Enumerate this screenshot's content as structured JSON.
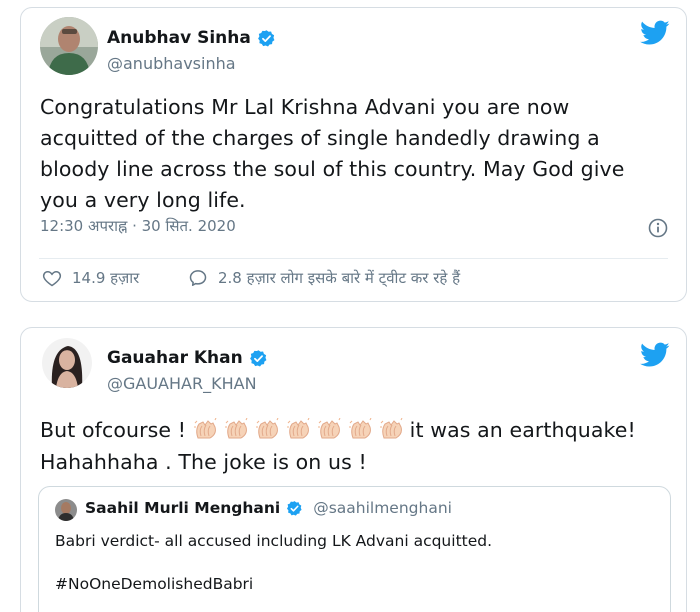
{
  "tweets": [
    {
      "author_name": "Anubhav Sinha",
      "handle": "@anubhavsinha",
      "text": "Congratulations Mr Lal Krishna Advani you are now acquitted of the charges of single handedly drawing a bloody line across the soul of this country. May God give you a very long life.",
      "timestamp": "12:30 अपराह्न · 30 सित. 2020",
      "likes": "14.9 हज़ार",
      "replies": "2.8 हज़ार लोग इसके बारे में ट्वीट कर रहे हैं"
    },
    {
      "author_name": "Gauahar Khan",
      "handle": "@GAUAHAR_KHAN",
      "text_before": "But ofcourse !",
      "clap_count": 7,
      "text_after": "it was an earthquake!",
      "text_line2": "Hahahhaha . The joke is on us !",
      "quoted": {
        "author_name": "Saahil Murli Menghani",
        "handle": "@saahilmenghani",
        "text": "Babri verdict- all accused including LK Advani acquitted.",
        "hashtag": "#NoOneDemolishedBabri"
      }
    }
  ],
  "icons": {
    "verified": "verified-badge-icon",
    "platform": "twitter-bird-icon",
    "info": "info-icon",
    "like": "heart-icon",
    "reply": "speech-bubble-icon",
    "clap": "clapping-hands-icon"
  },
  "colors": {
    "brand_blue": "#1da1f2",
    "text_primary": "#14171a",
    "text_secondary": "#657786",
    "border": "#d6dde3"
  }
}
